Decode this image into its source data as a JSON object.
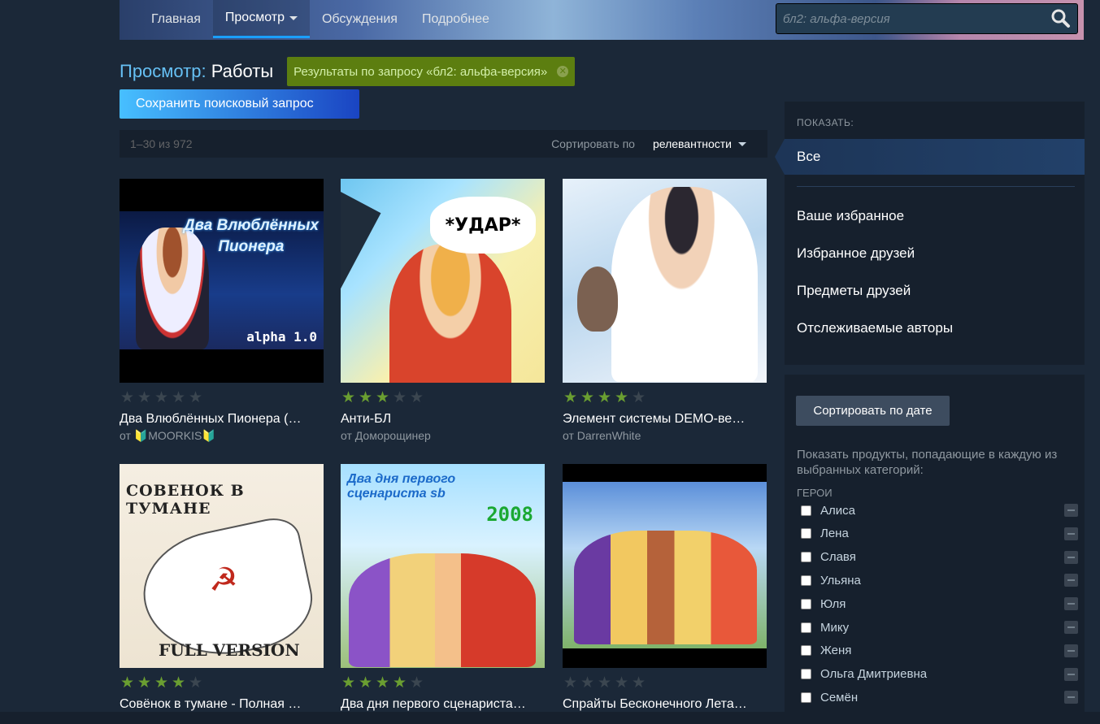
{
  "nav": {
    "items": [
      "Главная",
      "Просмотр",
      "Обсуждения",
      "Подробнее"
    ],
    "search_placeholder": "бл2: альфа-версия"
  },
  "page": {
    "title_prefix": "Просмотр:",
    "title": "Работы",
    "query_tag": "Результаты по запросу «бл2: альфа-версия»",
    "save_button": "Сохранить поисковый запрос"
  },
  "results": {
    "count": "1–30 из 972",
    "sort_label": "Сортировать по",
    "sort_value": "релевантности"
  },
  "items": [
    {
      "title": "Два Влюблённых Пионера (…",
      "author": "от 🔰MOORKIS🔰",
      "rating": 0,
      "thumb_text": [
        "Два Влюблённых",
        "Пионера",
        "alpha 1.0"
      ]
    },
    {
      "title": "Анти-БЛ",
      "author": "от Доморощинер",
      "rating": 3,
      "thumb_text": [
        "*УДАР*"
      ]
    },
    {
      "title": "Элемент системы DEMO-ве…",
      "author": "от DarrenWhite",
      "rating": 4,
      "thumb_text": []
    },
    {
      "title": "Совёнок в тумане - Полная …",
      "author": "",
      "rating": 4,
      "thumb_text": [
        "СОВЕНОК В ТУМАНЕ",
        "FULL VERSION"
      ]
    },
    {
      "title": "Два дня первого сценариста…",
      "author": "",
      "rating": 4,
      "thumb_text": [
        "Два дня первого",
        "сценариста sb",
        "2008"
      ]
    },
    {
      "title": "Спрайты Бесконечного Лета…",
      "author": "",
      "rating": 0,
      "thumb_text": []
    }
  ],
  "sidebar": {
    "show_header": "ПОКАЗАТЬ:",
    "filters": [
      "Все",
      "Ваше избранное",
      "Избранное друзей",
      "Предметы друзей",
      "Отслеживаемые авторы"
    ],
    "sort_date_button": "Сортировать по дате",
    "description": "Показать продукты, попадающие в каждую из выбранных категорий:",
    "category_header": "ГЕРОИ",
    "tags": [
      "Алиса",
      "Лена",
      "Славя",
      "Ульяна",
      "Юля",
      "Мику",
      "Женя",
      "Ольга Дмитриевна",
      "Семён"
    ]
  },
  "colors": {
    "background": "#1b2838",
    "accent": "#66c0f4",
    "tag_green": "#5c7e10",
    "star_on": "#6a9e31"
  }
}
